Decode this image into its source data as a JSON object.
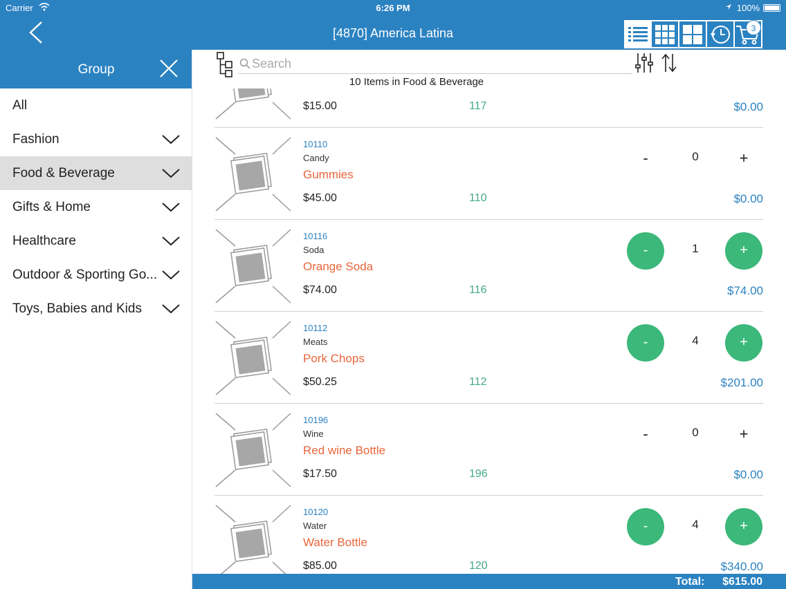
{
  "status_bar": {
    "carrier": "Carrier",
    "time": "6:26 PM",
    "battery": "100%"
  },
  "header": {
    "title": "[4870] America Latina",
    "cart_count": "3"
  },
  "sidebar": {
    "title": "Group",
    "items": [
      {
        "label": "All"
      },
      {
        "label": "Fashion"
      },
      {
        "label": "Food & Beverage"
      },
      {
        "label": "Gifts & Home"
      },
      {
        "label": "Healthcare"
      },
      {
        "label": "Outdoor & Sporting Go..."
      },
      {
        "label": "Toys, Babies and Kids"
      }
    ],
    "selected": "Food & Beverage"
  },
  "search": {
    "placeholder": "Search"
  },
  "list_count": "10 Items in Food & Beverage",
  "items": [
    {
      "price": "$15.00",
      "stock": "117",
      "total": "$0.00"
    },
    {
      "sku": "10110",
      "category": "Candy",
      "name": "Gummies",
      "price": "$45.00",
      "stock": "110",
      "qty": "0",
      "total": "$0.00",
      "minus": "-",
      "plus": "+"
    },
    {
      "sku": "10116",
      "category": "Soda",
      "name": "Orange Soda",
      "price": "$74.00",
      "stock": "116",
      "qty": "1",
      "total": "$74.00",
      "minus": "-",
      "plus": "+"
    },
    {
      "sku": "10112",
      "category": "Meats",
      "name": "Pork Chops",
      "price": "$50.25",
      "stock": "112",
      "qty": "4",
      "total": "$201.00",
      "minus": "-",
      "plus": "+"
    },
    {
      "sku": "10196",
      "category": "Wine",
      "name": "Red wine Bottle",
      "price": "$17.50",
      "stock": "196",
      "qty": "0",
      "total": "$0.00",
      "minus": "-",
      "plus": "+"
    },
    {
      "sku": "10120",
      "category": "Water",
      "name": "Water Bottle",
      "price": "$85.00",
      "stock": "120",
      "qty": "4",
      "total": "$340.00",
      "minus": "-",
      "plus": "+"
    }
  ],
  "footer": {
    "total_label": "Total:",
    "total_value": "$615.00"
  },
  "colors": {
    "accent": "#2b82c1",
    "green": "#3bb87a",
    "orange": "#e8663a",
    "stock": "#45a88a"
  }
}
